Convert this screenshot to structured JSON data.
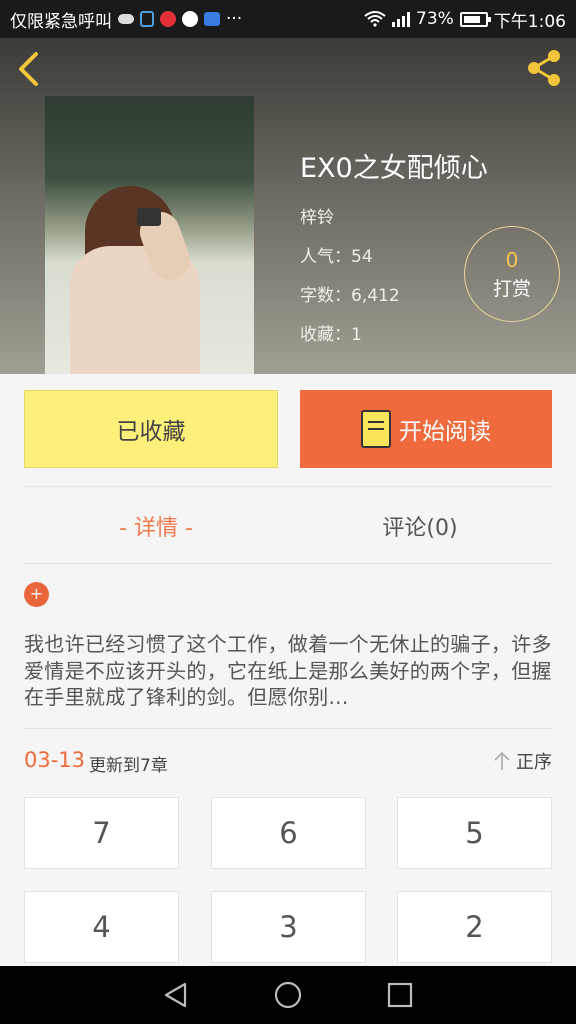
{
  "status_bar": {
    "app_text": "仅限紧急呼叫",
    "battery": "73%",
    "time": "下午1:06",
    "dots": "···"
  },
  "book": {
    "title": "EX0之女配倾心",
    "author": "梓铃",
    "popularity": "人气：54",
    "word_count": "字数：6,412",
    "favorites": "收藏：1"
  },
  "tip": {
    "count": "0",
    "label": "打赏"
  },
  "actions": {
    "favorited_label": "已收藏",
    "read_label": "开始阅读"
  },
  "tabs": {
    "detail": "- 详情 -",
    "comments": "评论(0)"
  },
  "detail": {
    "plus": "+",
    "synopsis": "我也许已经习惯了这个工作，做着一个无休止的骗子，许多爱情是不应该开头的，它在纸上是那么美好的两个字，但握在手里就成了锋利的剑。但愿你别..."
  },
  "update": {
    "date": "03-13",
    "text": "更新到7章",
    "sort_label": "正序"
  },
  "chapters": [
    "7",
    "6",
    "5",
    "4",
    "3",
    "2"
  ],
  "icons": {
    "back": "chevron-left-icon",
    "share": "share-icon",
    "read": "book-icon",
    "sort": "arrow-up-icon"
  },
  "colors": {
    "accent": "#ef6a3c",
    "favorite_bg": "#fcf07a",
    "tip_number": "#f3c34d"
  }
}
